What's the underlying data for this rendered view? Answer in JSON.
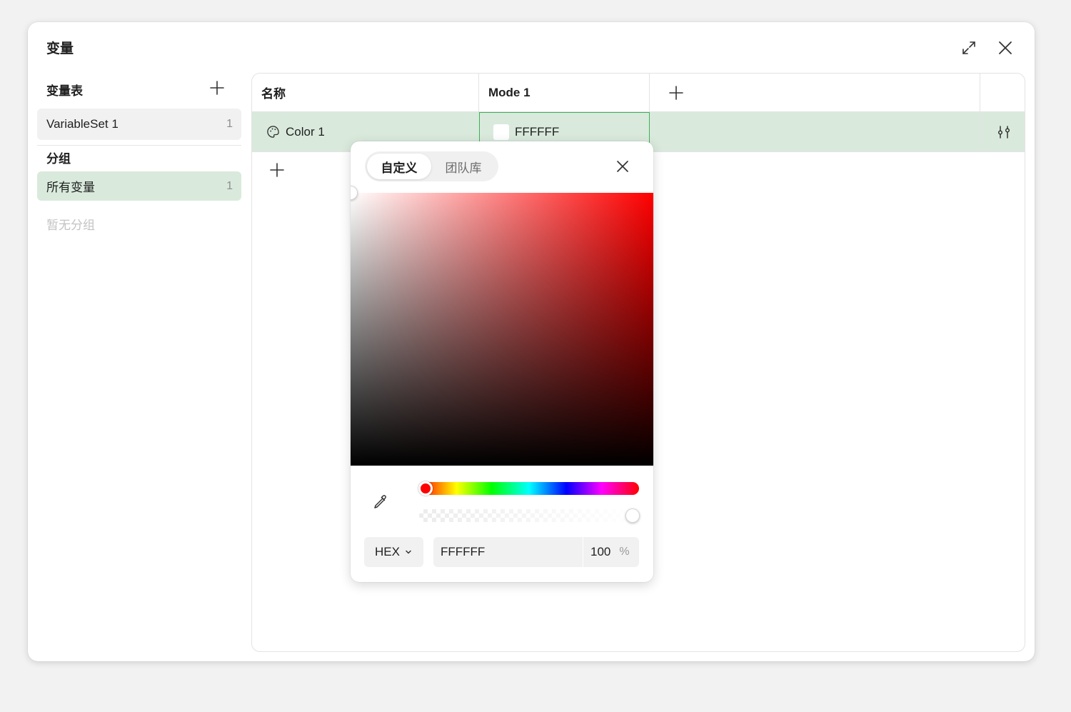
{
  "dialog": {
    "title": "变量"
  },
  "sidebar": {
    "sets_header": "变量表",
    "sets": [
      {
        "name": "VariableSet 1",
        "count": "1"
      }
    ],
    "groups_header": "分组",
    "groups": [
      {
        "name": "所有变量",
        "count": "1"
      }
    ],
    "empty_groups": "暂无分组"
  },
  "table": {
    "columns": [
      "名称",
      "Mode 1"
    ],
    "rows": [
      {
        "name": "Color 1",
        "value": "FFFFFF",
        "swatch": "#FFFFFF"
      }
    ]
  },
  "picker": {
    "tabs": [
      {
        "label": "自定义",
        "active": true
      },
      {
        "label": "团队库",
        "active": false
      }
    ],
    "hue_color": "#FF0000",
    "format": "HEX",
    "hex": "FFFFFF",
    "alpha": "100",
    "alpha_unit": "%"
  },
  "colors": {
    "selected_row": "#D9EADC",
    "accent": "#3FAE5C"
  },
  "icons": {
    "expand": "expand-icon",
    "close": "close-icon",
    "add": "plus-icon",
    "palette": "palette-icon",
    "adjust": "sliders-icon",
    "dropper": "eyedropper-icon",
    "chevron": "chevron-down-icon"
  }
}
